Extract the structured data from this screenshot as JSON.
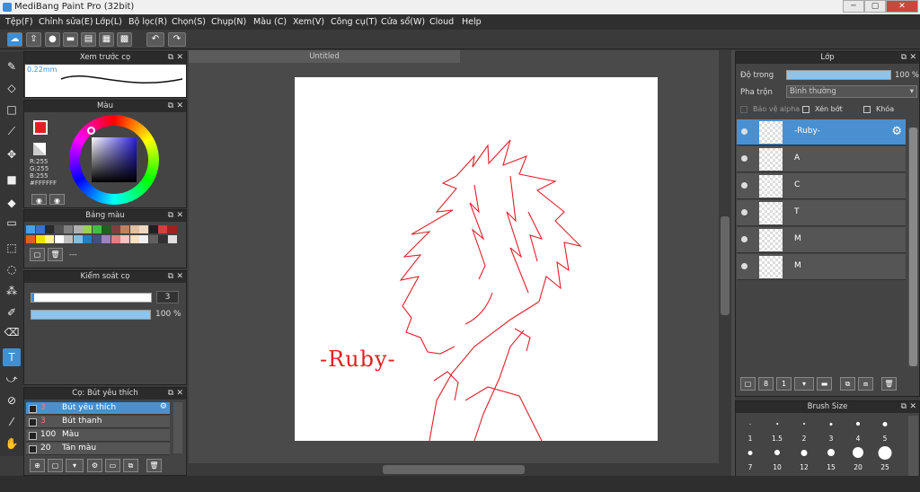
{
  "window": {
    "title": "MediBang Paint Pro (32bit)",
    "minimize": "─",
    "maximize": "▢",
    "close": "✕"
  },
  "menu": [
    "Tệp(F)",
    "Chỉnh sửa(E)",
    "Lớp(L)",
    "Bộ lọc(R)",
    "Chọn(S)",
    "Chụp(N)",
    "Màu (C)",
    "Xem(V)",
    "Công cụ(T)",
    "Cửa sổ(W)",
    "Cloud",
    "Help"
  ],
  "toolbar": {
    "icons": [
      "cloud-icon",
      "export-icon",
      "comment-icon",
      "chat-icon",
      "document-icon",
      "image-list-icon",
      "grid-icon"
    ],
    "undo": "↶",
    "redo": "↷"
  },
  "tools": [
    {
      "name": "brush-tool-icon",
      "glyph": "✎"
    },
    {
      "name": "eraser-tool-icon",
      "glyph": "◇"
    },
    {
      "name": "shape-tool-icon",
      "glyph": "□"
    },
    {
      "name": "line-tool-icon",
      "glyph": "⟋"
    },
    {
      "name": "move-tool-icon",
      "glyph": "✥"
    },
    {
      "name": "fill-rect-tool-icon",
      "glyph": "■"
    },
    {
      "name": "bucket-tool-icon",
      "glyph": "◆"
    },
    {
      "name": "gradient-tool-icon",
      "glyph": "▭"
    },
    {
      "name": "select-rect-tool-icon",
      "glyph": "⬚"
    },
    {
      "name": "lasso-tool-icon",
      "glyph": "◌"
    },
    {
      "name": "magic-wand-tool-icon",
      "glyph": "⁂"
    },
    {
      "name": "select-pen-tool-icon",
      "glyph": "✐"
    },
    {
      "name": "select-eraser-tool-icon",
      "glyph": "⌫"
    },
    {
      "name": "text-tool-icon",
      "glyph": "T"
    },
    {
      "name": "operation-tool-icon",
      "glyph": "⤻"
    },
    {
      "name": "eyedropper-tool-icon",
      "glyph": "⊘"
    },
    {
      "name": "dropper2-tool-icon",
      "glyph": "⁄"
    },
    {
      "name": "hand-tool-icon",
      "glyph": "✋"
    }
  ],
  "brush_preview": {
    "title": "Xem trước cọ",
    "size": "0.22mm"
  },
  "color": {
    "title": "Màu",
    "r": "R:255",
    "g": "G:255",
    "b": "B:255",
    "hex": "#FFFFFF",
    "primary": "#e02020",
    "secondary": "#ffffff"
  },
  "palette": {
    "title": "Bảng màu",
    "dash": "---",
    "row1": [
      "#4aa0e0",
      "#3b6fd0",
      "#2a2a2a",
      "#505050",
      "#808080",
      "#b0b0b0",
      "#9ad050",
      "#40c040",
      "#206020",
      "#804040",
      "#c08060",
      "#e0c0a0",
      "#f0d8c0",
      "#202020",
      "#d04040",
      "#a02020"
    ],
    "row2": [
      "#e06020",
      "#f0e000",
      "#fff0a0",
      "#ffffff",
      "#c0c0c0",
      "#80c0e0",
      "#2080c0",
      "#405080",
      "#a080c0",
      "#e08080",
      "#ffc0c0",
      "#ffe0c0",
      "#f0f0f0",
      "#606060",
      "#303030",
      "#e0e0e0"
    ]
  },
  "brush_control": {
    "title": "Kiểm soát cọ",
    "size_value": "3",
    "opacity_value": "100 %",
    "size_fraction": 0.02,
    "opacity_fraction": 1.0
  },
  "brush_list": {
    "title": "Cọ: Bút yêu thích",
    "items": [
      {
        "size": "3",
        "name": "Bút yêu thích",
        "selected": true
      },
      {
        "size": "3",
        "name": "Bút thanh",
        "selected": false
      },
      {
        "size": "100",
        "name": "Màu",
        "selected": false
      },
      {
        "size": "20",
        "name": "Tán màu",
        "selected": false
      }
    ]
  },
  "document": {
    "tab": "Untitled",
    "signature": "-Ruby-"
  },
  "layers": {
    "title": "Lớp",
    "opacity_label": "Độ trong",
    "opacity_value": "100 %",
    "blend_label": "Pha trộn",
    "blend_value": "Bình thường",
    "protect_alpha": "Bảo vệ alpha",
    "clipping": "Xén bớt",
    "lock": "Khóa",
    "items": [
      {
        "name": "-Ruby-",
        "selected": true
      },
      {
        "name": "A",
        "selected": false
      },
      {
        "name": "C",
        "selected": false
      },
      {
        "name": "T",
        "selected": false
      },
      {
        "name": "M",
        "selected": false
      },
      {
        "name": "M",
        "selected": false
      }
    ]
  },
  "brush_size": {
    "title": "Brush Size",
    "row1": [
      "1",
      "1.5",
      "2",
      "3",
      "4",
      "5"
    ],
    "row2": [
      "7",
      "10",
      "12",
      "15",
      "20",
      "25"
    ]
  }
}
